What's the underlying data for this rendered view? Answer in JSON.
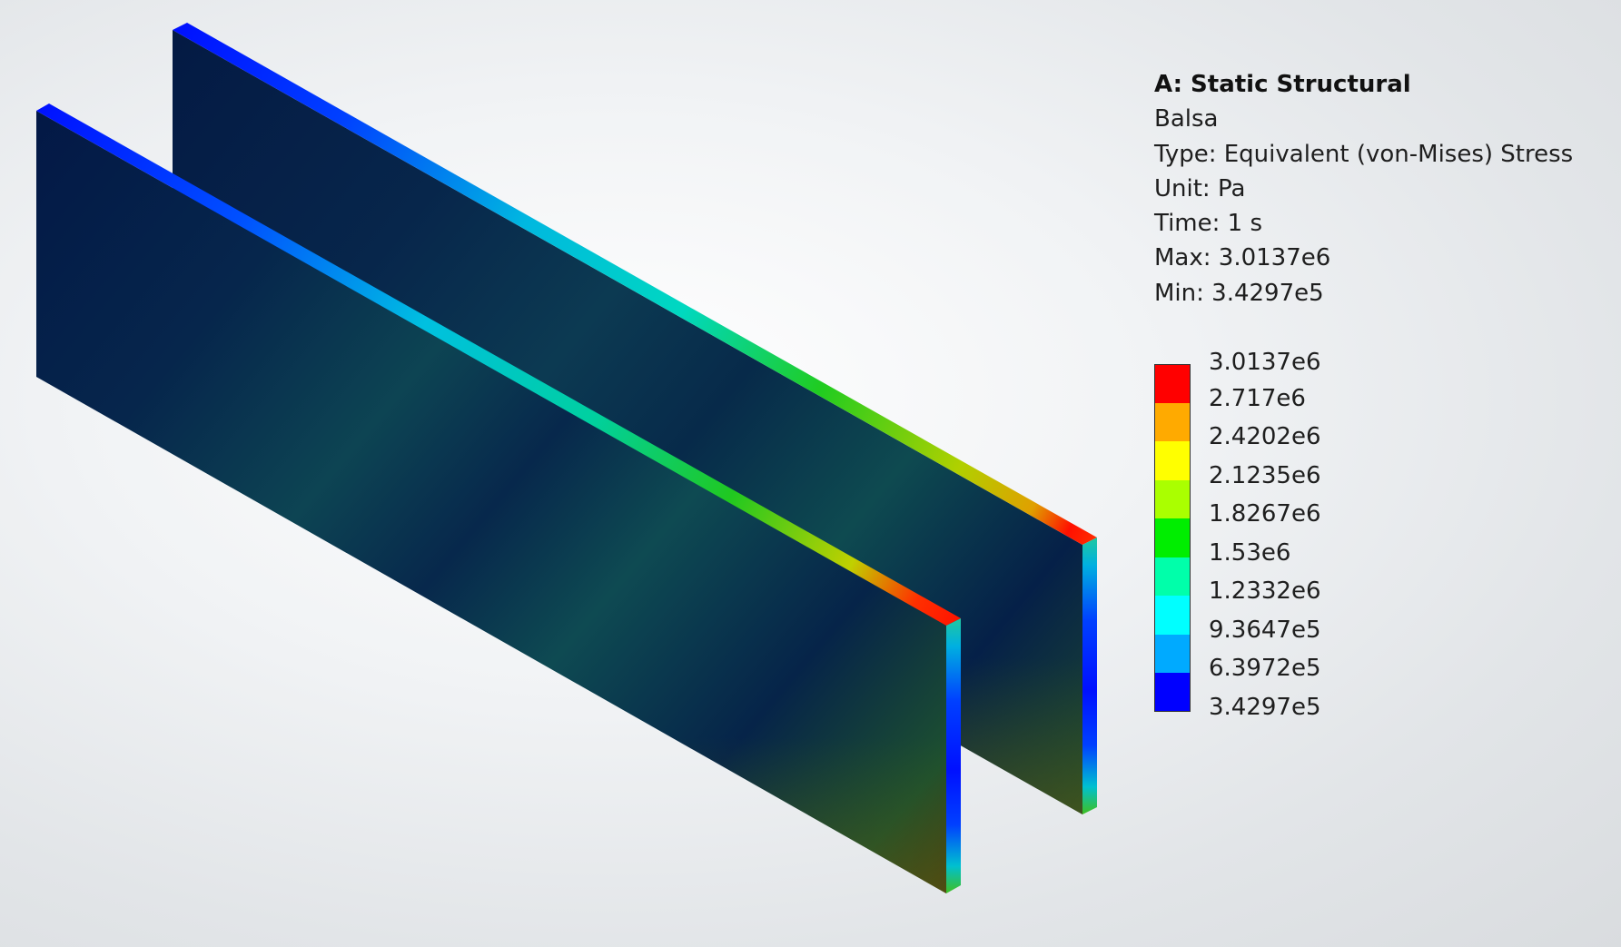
{
  "result": {
    "title": "A: Static Structural",
    "material": "Balsa",
    "type_line": "Type: Equivalent (von-Mises) Stress",
    "unit_line": "Unit: Pa",
    "time_line": "Time: 1 s",
    "max_line": "Max: 3.0137e6",
    "min_line": "Min: 3.4297e5"
  },
  "legend": {
    "labels": [
      "3.0137e6",
      "2.717e6",
      "2.4202e6",
      "2.1235e6",
      "1.8267e6",
      "1.53e6",
      "1.2332e6",
      "9.3647e5",
      "6.3972e5",
      "3.4297e5"
    ],
    "colors": [
      "#ff0000",
      "#ffaa00",
      "#ffff00",
      "#aaff00",
      "#00ee00",
      "#00ffaa",
      "#00ffff",
      "#00aaff",
      "#0000ff"
    ]
  },
  "model": {
    "face_color": "#05204a",
    "low_color": "#0000ff",
    "mid_color": "#00d8d8",
    "high_color": "#ff0000"
  }
}
